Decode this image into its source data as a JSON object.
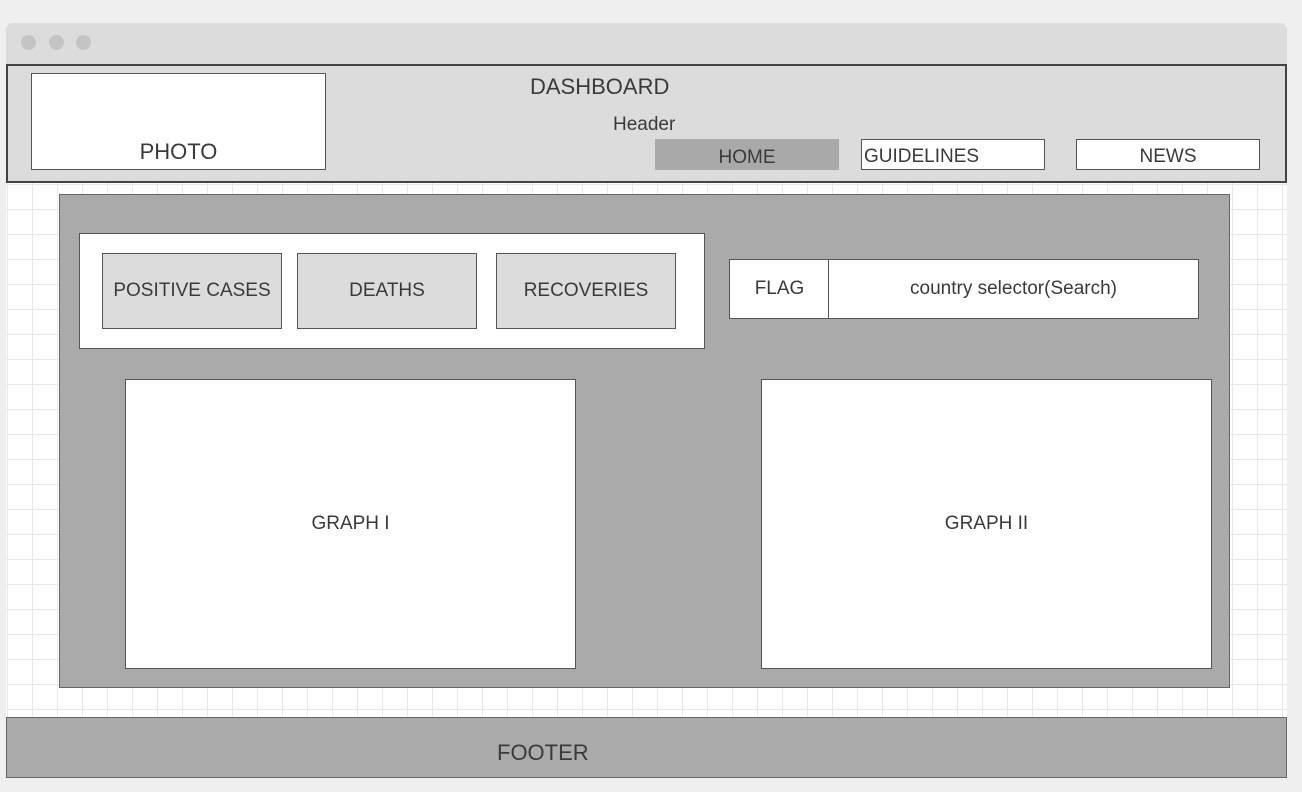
{
  "header": {
    "photo_label": "PHOTO",
    "title": "DASHBOARD",
    "subtitle": "Header",
    "nav": {
      "home": "HOME",
      "guidelines": "GUIDELINES",
      "news": "NEWS"
    }
  },
  "stats": {
    "positive_cases": "POSITIVE CASES",
    "deaths": "DEATHS",
    "recoveries": "RECOVERIES"
  },
  "country": {
    "flag_label": "FLAG",
    "search_label": "country selector(Search)"
  },
  "graphs": {
    "graph_1": "GRAPH I",
    "graph_2": "GRAPH II"
  },
  "footer": {
    "label": "FOOTER"
  },
  "colors": {
    "header_bg": "#dcdcdc",
    "panel_bg": "#aaaaaa",
    "active_nav": "#a9a9a9"
  }
}
